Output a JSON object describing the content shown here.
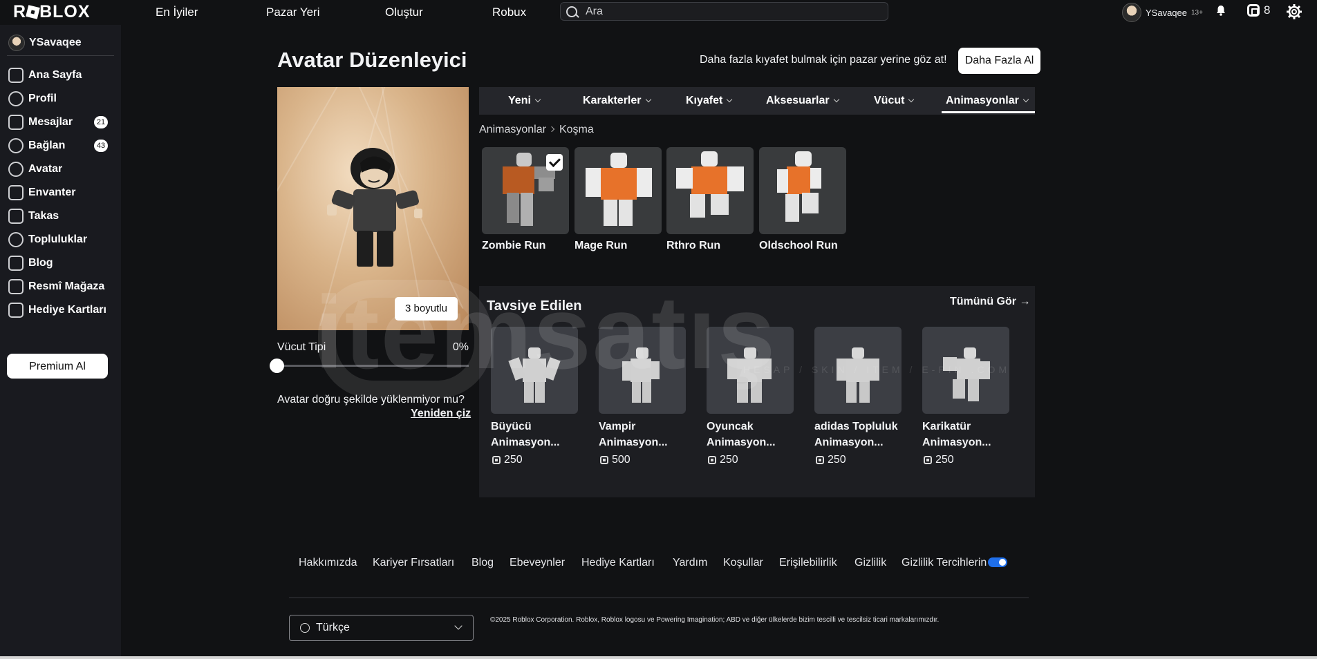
{
  "topbar": {
    "logo": "ROBLOX",
    "nav": [
      "En İyiler",
      "Pazar Yeri",
      "Oluştur",
      "Robux"
    ],
    "search_placeholder": "Ara",
    "username": "YSavaqee",
    "age_label": "13+",
    "robux_balance": "8"
  },
  "sidebar": {
    "username": "YSavaqee",
    "items": [
      {
        "label": "Ana Sayfa",
        "icon": "home-icon"
      },
      {
        "label": "Profil",
        "icon": "profile-icon"
      },
      {
        "label": "Mesajlar",
        "icon": "messages-icon",
        "badge": "21"
      },
      {
        "label": "Bağlan",
        "icon": "friends-icon",
        "badge": "43"
      },
      {
        "label": "Avatar",
        "icon": "avatar-icon"
      },
      {
        "label": "Envanter",
        "icon": "inventory-icon"
      },
      {
        "label": "Takas",
        "icon": "trade-icon"
      },
      {
        "label": "Topluluklar",
        "icon": "groups-icon"
      },
      {
        "label": "Blog",
        "icon": "blog-icon"
      },
      {
        "label": "Resmî Mağaza",
        "icon": "store-icon"
      },
      {
        "label": "Hediye Kartları",
        "icon": "gift-card-icon"
      }
    ],
    "premium_label": "Premium Al"
  },
  "main": {
    "title": "Avatar Düzenleyici",
    "promo_text": "Daha fazla kıyafet bulmak için pazar yerine göz at!",
    "more_button": "Daha Fazla Al",
    "three_d_button": "3 boyutlu",
    "body_type_label": "Vücut Tipi",
    "body_type_value": "0%",
    "body_type_level": 0,
    "load_question": "Avatar doğru şekilde yüklenmiyor mu?",
    "redraw_link": "Yeniden çiz",
    "tabs": [
      "Yeni",
      "Karakterler",
      "Kıyafet",
      "Aksesuarlar",
      "Vücut",
      "Animasyonlar"
    ],
    "active_tab": "Animasyonlar",
    "breadcrumb": [
      "Animasyonlar",
      "Koşma"
    ],
    "animations": [
      {
        "name": "Zombie Run",
        "selected": true
      },
      {
        "name": "Mage Run",
        "selected": false
      },
      {
        "name": "Rthro Run",
        "selected": false
      },
      {
        "name": "Oldschool Run",
        "selected": false
      }
    ]
  },
  "recommended": {
    "title": "Tavsiye Edilen",
    "see_all": "Tümünü Gör",
    "items": [
      {
        "name": "Büyücü Animasyon...",
        "price": "250"
      },
      {
        "name": "Vampir Animasyon...",
        "price": "500"
      },
      {
        "name": "Oyuncak Animasyon...",
        "price": "250"
      },
      {
        "name": "adidas Topluluk Animasyon...",
        "price": "250"
      },
      {
        "name": "Karikatür Animasyon...",
        "price": "250"
      }
    ]
  },
  "watermark": {
    "text": "itemsatış",
    "sub": "HESAP / SKIN / ITEM / E-PIN .COM"
  },
  "footer": {
    "links": [
      "Hakkımızda",
      "Kariyer Fırsatları",
      "Blog",
      "Ebeveynler",
      "Hediye Kartları",
      "Yardım",
      "Koşullar",
      "Erişilebilirlik",
      "Gizlilik",
      "Gizlilik Tercihlerin"
    ],
    "language": "Türkçe",
    "copyright": "©2025 Roblox Corporation. Roblox, Roblox logosu ve Powering Imagination; ABD ve diğer ülkelerde bizim tescilli ve tescilsiz ticari markalarımızdır."
  },
  "colors": {
    "background": "#111214",
    "sidebar": "#191a1f",
    "panel": "#1d1e22",
    "tabbar": "#25262b",
    "toggle_accent": "#1f6feb"
  }
}
